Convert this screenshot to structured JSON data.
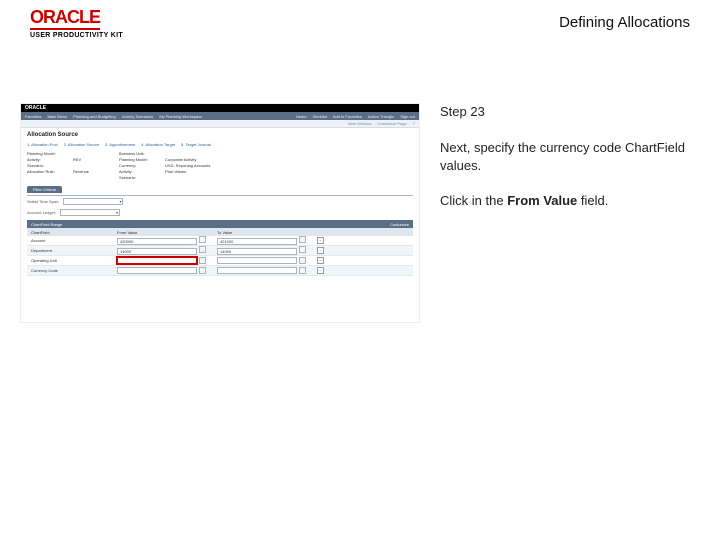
{
  "header": {
    "logo_text": "ORACLE",
    "subtitle": "USER PRODUCTIVITY KIT",
    "doc_title": "Defining Allocations"
  },
  "screenshot": {
    "brand": "ORACLE",
    "menu_left": [
      "Favorites",
      "Main Menu",
      "Planning and Budgeting",
      "Activity Scenarios",
      "My Planning Workspace"
    ],
    "menu_right": [
      "Home",
      "Worklist",
      "Add to Favorites",
      "Action Triangle",
      "Sign out"
    ],
    "subbar": [
      "New Window",
      "Customize Page"
    ],
    "page_heading": "Allocation Source",
    "steps": [
      "1. Allocation Pool",
      "2. Allocation Source",
      "3. Apportionment",
      "4. Allocation Target",
      "5. Target Journal"
    ],
    "left_labels": [
      "Planning Model:",
      "Activity:",
      "Scenario:",
      "Allocation Rule:"
    ],
    "left_vals": [
      "",
      "REV",
      "",
      "Revenue"
    ],
    "right_labels": [
      "Business Unit:",
      "Planning Model:",
      "Currency:",
      "Activity:",
      "Scenario:"
    ],
    "right_vals": [
      "",
      "Corporate Activity",
      "USD, Reporting Accounts",
      "Plan Values",
      ""
    ],
    "tab_label": "Filter Criteria",
    "timespan_label": "Select Time Span:",
    "ledger_label": "Account Ledger:",
    "grid_title": "ChartField Range",
    "grid_customize": "Customize",
    "col1": "ChartField",
    "col2": "From Value",
    "col3": "To Value",
    "row1_cf": "Account",
    "row1_from": "420000",
    "row1_to": "421000",
    "row2_cf": "Department",
    "row2_from": "14000",
    "row2_to": "14000",
    "row3_cf": "Operating Unit",
    "row3_from": "",
    "row3_to": "",
    "row4_cf": "Currency Code",
    "row4_from": "",
    "row4_to": ""
  },
  "instructions": {
    "step": "Step 23",
    "body": "Next, specify the currency code ChartField values.",
    "action_pre": "Click in the ",
    "action_bold": "From Value",
    "action_post": " field."
  }
}
